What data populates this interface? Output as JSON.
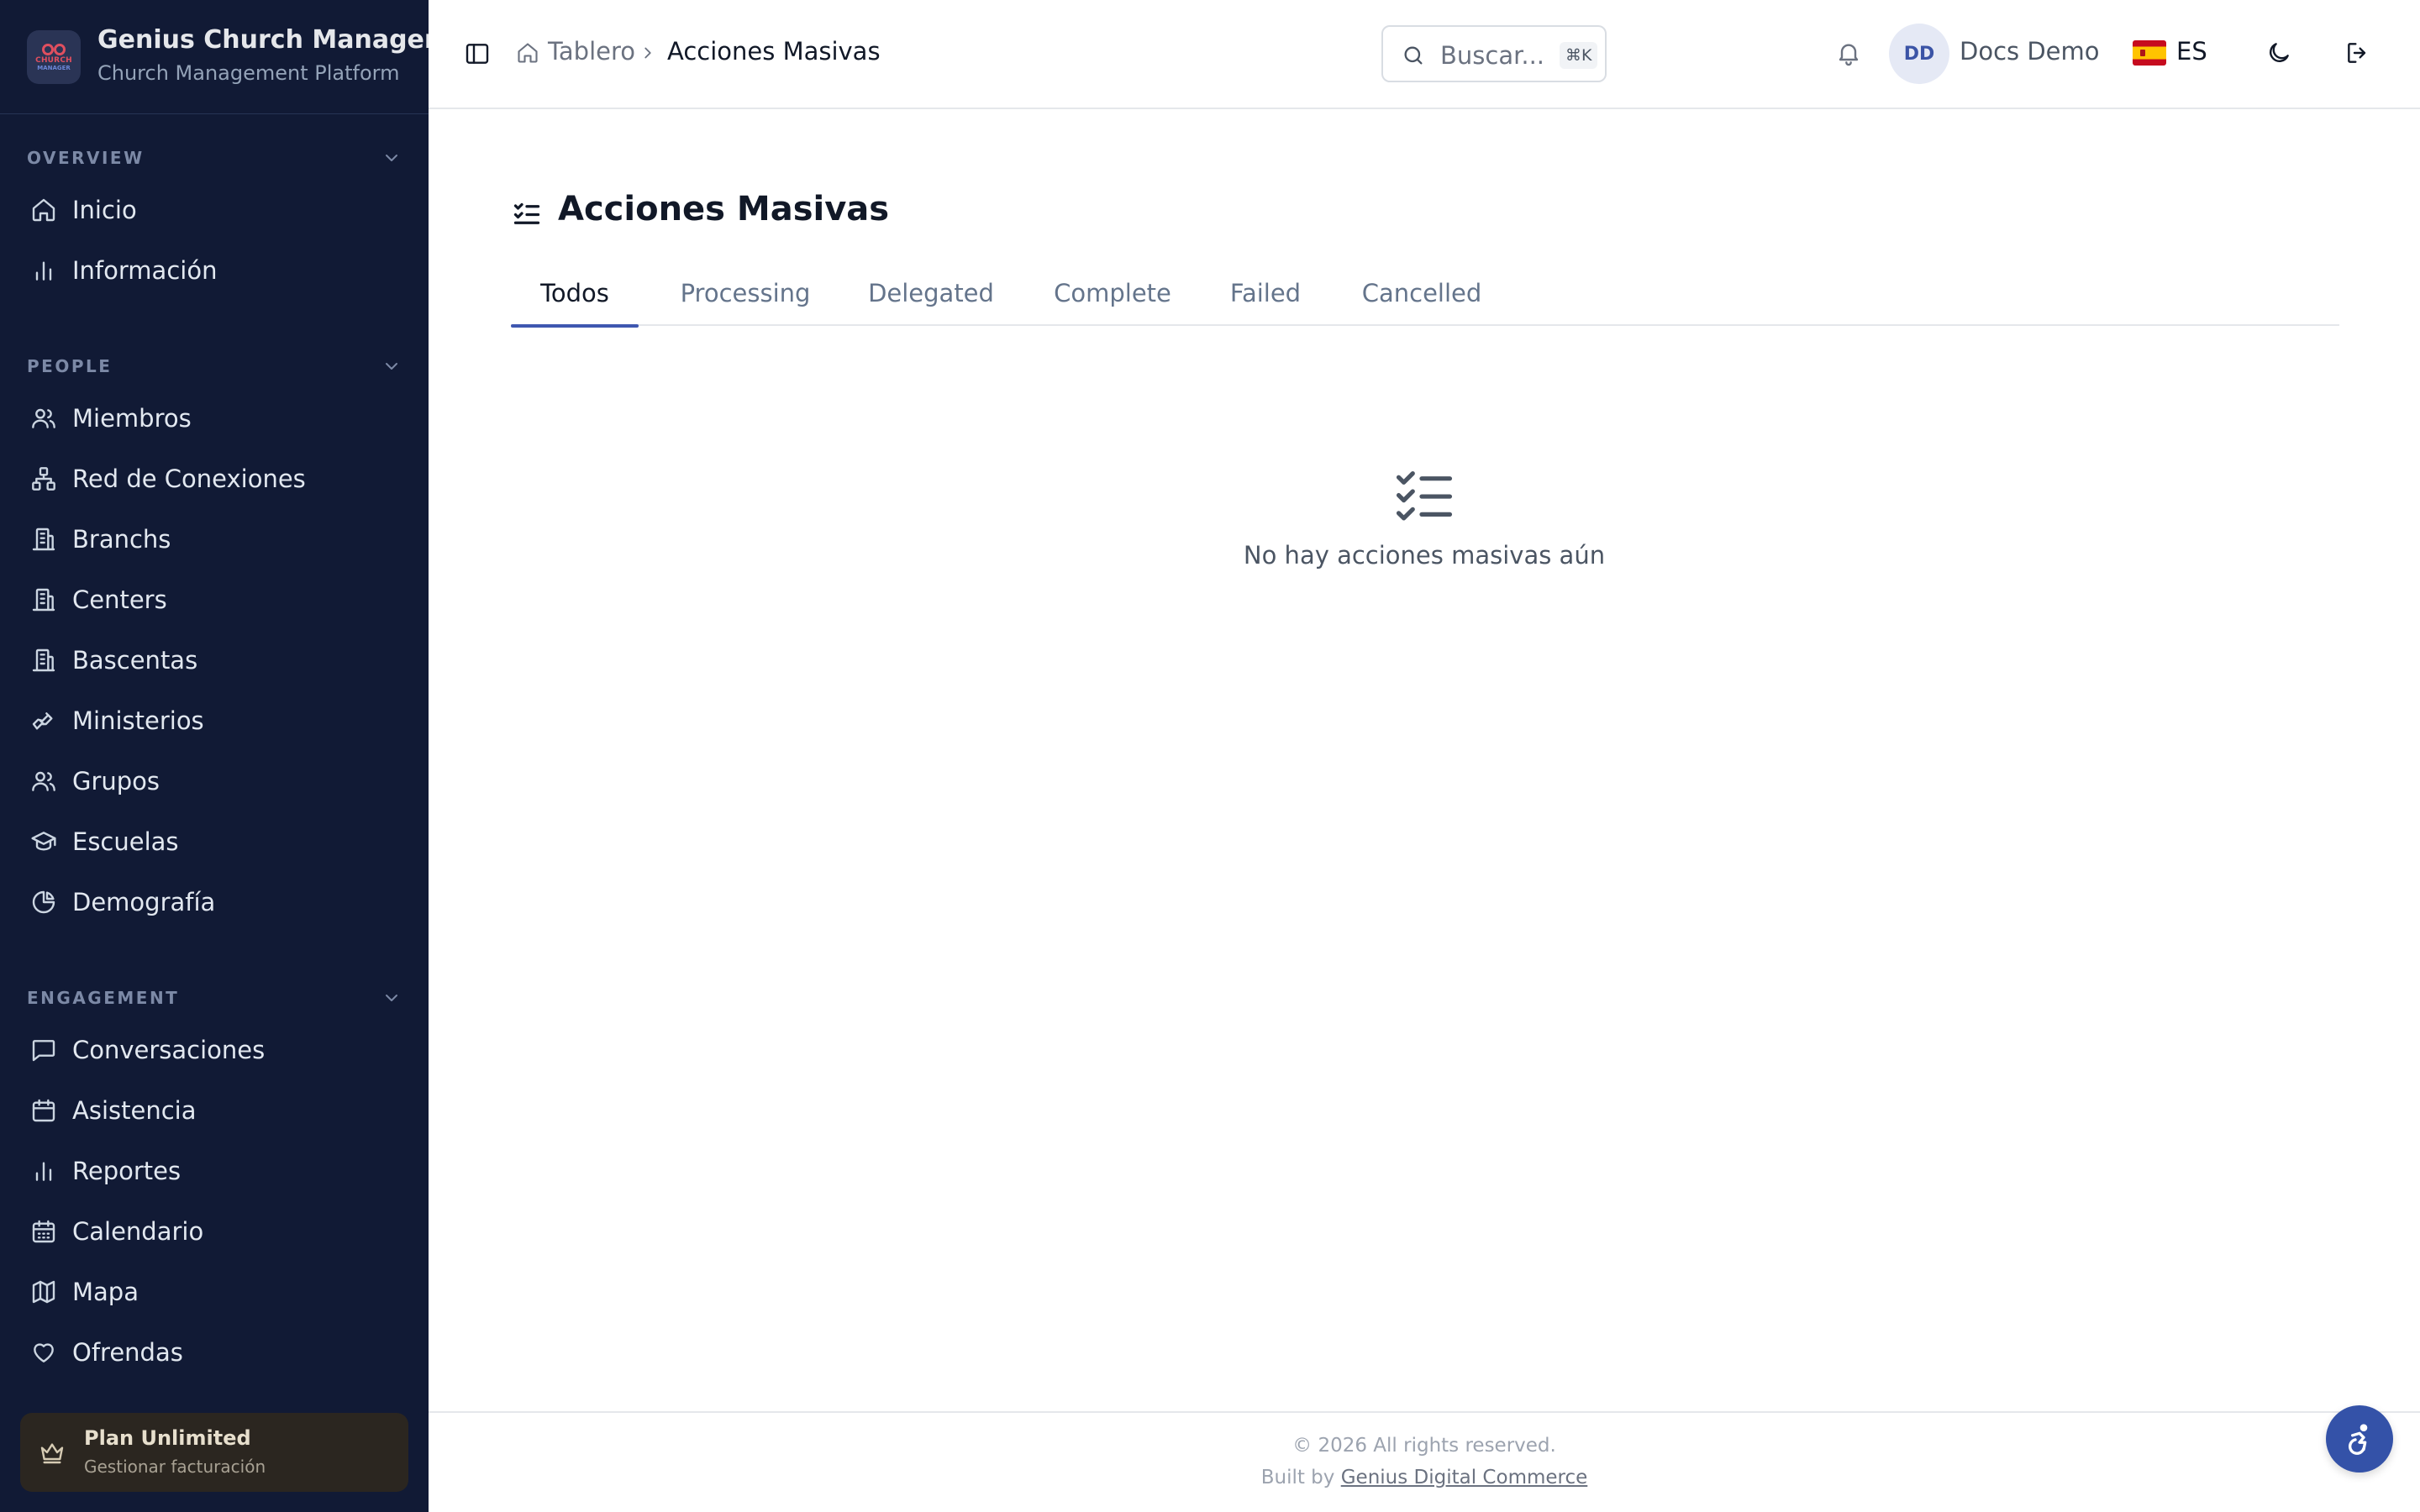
{
  "app": {
    "title": "Genius Church Manager",
    "subtitle": "Church Management Platform",
    "logo_text_top": "CHURCH",
    "logo_text_bottom": "MANAGER"
  },
  "sidebar": {
    "sections": [
      {
        "label": "OVERVIEW",
        "items": [
          {
            "label": "Inicio",
            "icon": "home-icon"
          },
          {
            "label": "Información",
            "icon": "bar-chart-icon"
          }
        ]
      },
      {
        "label": "PEOPLE",
        "items": [
          {
            "label": "Miembros",
            "icon": "users-icon"
          },
          {
            "label": "Red de Conexiones",
            "icon": "network-icon"
          },
          {
            "label": "Branchs",
            "icon": "building-icon"
          },
          {
            "label": "Centers",
            "icon": "building-icon"
          },
          {
            "label": "Bascentas",
            "icon": "building-icon"
          },
          {
            "label": "Ministerios",
            "icon": "hand-heart-icon"
          },
          {
            "label": "Grupos",
            "icon": "users-icon"
          },
          {
            "label": "Escuelas",
            "icon": "graduation-cap-icon"
          },
          {
            "label": "Demografía",
            "icon": "pie-chart-icon"
          }
        ]
      },
      {
        "label": "ENGAGEMENT",
        "items": [
          {
            "label": "Conversaciones",
            "icon": "message-square-icon"
          },
          {
            "label": "Asistencia",
            "icon": "calendar-icon"
          },
          {
            "label": "Reportes",
            "icon": "bar-chart-icon"
          },
          {
            "label": "Calendario",
            "icon": "calendar-days-icon"
          },
          {
            "label": "Mapa",
            "icon": "map-icon"
          },
          {
            "label": "Ofrendas",
            "icon": "heart-icon"
          }
        ]
      }
    ],
    "plan": {
      "title": "Plan Unlimited",
      "subtitle": "Gestionar facturación",
      "icon": "crown-icon"
    }
  },
  "topbar": {
    "breadcrumb": [
      "Tablero",
      "Acciones Masivas"
    ],
    "search_placeholder": "Buscar...",
    "search_shortcut": "⌘K",
    "user_initials": "DD",
    "user_name": "Docs Demo",
    "language_code": "ES",
    "language_flag": "spain-flag-icon"
  },
  "main": {
    "title": "Acciones Masivas",
    "tabs": [
      "Todos",
      "Processing",
      "Delegated",
      "Complete",
      "Failed",
      "Cancelled"
    ],
    "active_tab": "Todos",
    "empty_message": "No hay acciones masivas aún"
  },
  "footer": {
    "copyright": "© 2026 All rights reserved.",
    "built_by_prefix": "Built by",
    "built_by_link": "Genius Digital Commerce"
  },
  "colors": {
    "sidebar_bg": "#111a35",
    "accent": "#3f57b0",
    "a11y_button": "#3452a8"
  }
}
